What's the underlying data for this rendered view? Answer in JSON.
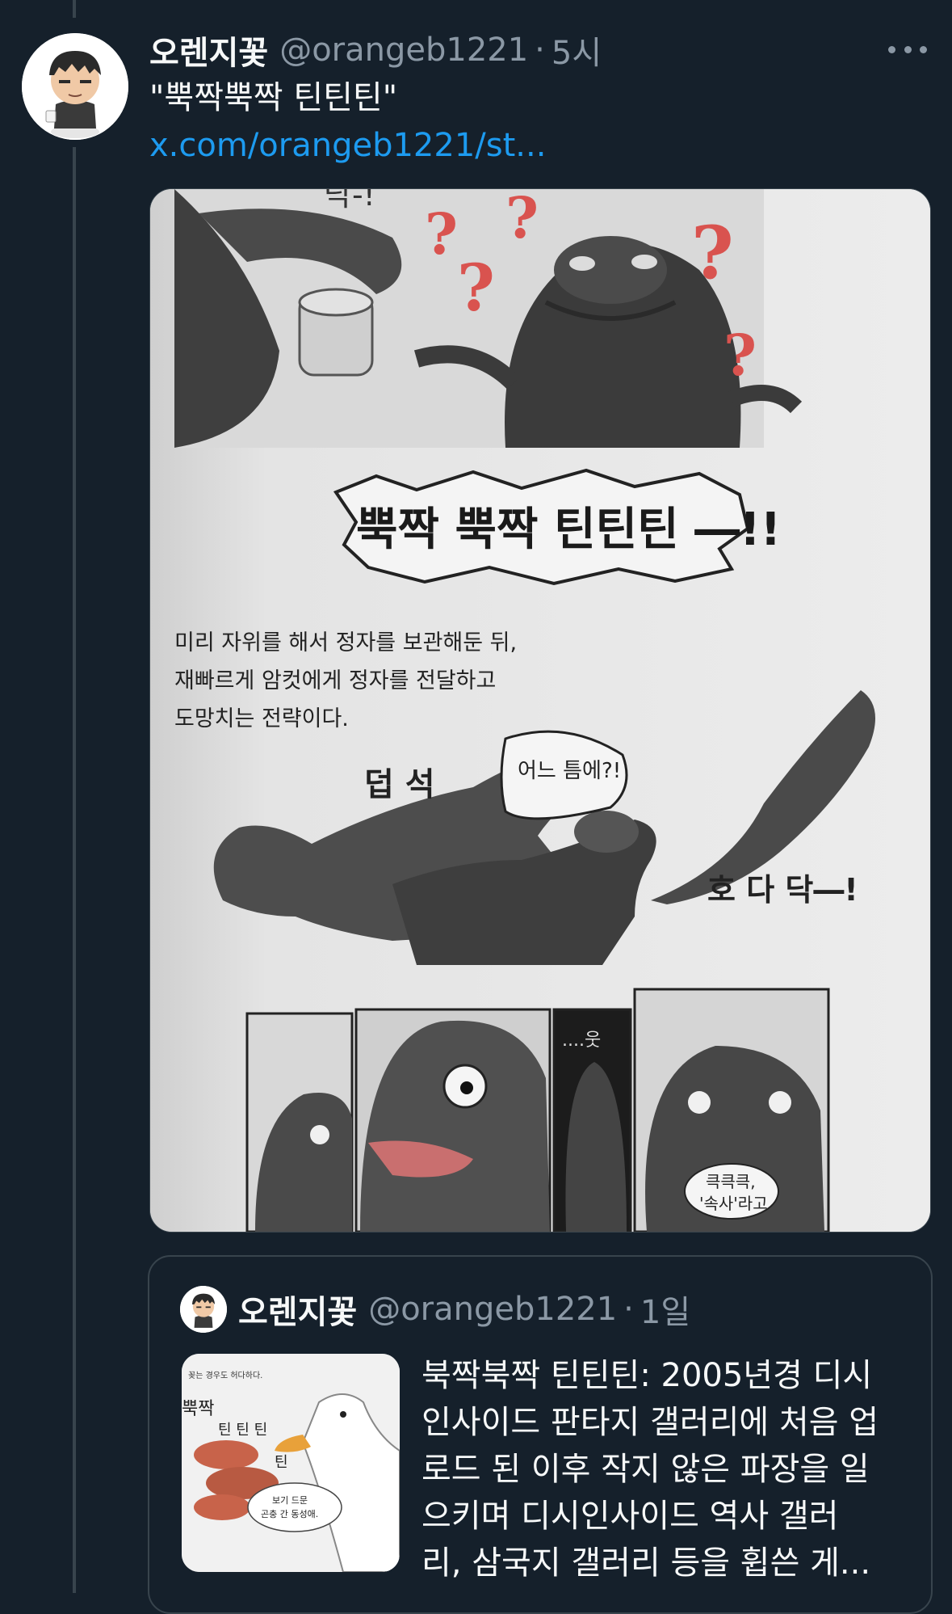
{
  "tweet": {
    "author_name": "오렌지꽃",
    "author_handle": "@orangeb1221",
    "separator": "·",
    "time": "5시",
    "text": "\"뿍짝뿍짝 틴틴틴\"",
    "link": "x.com/orangeb1221/st..."
  },
  "media": {
    "comic_texts": {
      "shout": "뿍짝 뿍짝 틴틴틴 ―!!",
      "narration_1": "미리 자위를 해서 정자를 보관해둔 뒤,",
      "narration_2": "재빠르게 암컷에게 정자를 전달하고",
      "narration_3": "도망치는 전략이다.",
      "sfx_grab": "덥 석",
      "speech_when": "어느 틈에?!",
      "sfx_run": "호 다 닥―!",
      "sfx_dots": "....웃",
      "speech_laugh_1": "큭큭큭,",
      "speech_laugh_2": "'속사'라고",
      "sfx_top": "닥-!"
    }
  },
  "quote": {
    "author_name": "오렌지꽃",
    "author_handle": "@orangeb1221",
    "separator": "·",
    "time": "1일",
    "lines": [
      "북짝북짝 틴틴틴: 2005년경 디시",
      "인사이드 판타지 갤러리에 처음 업",
      "로드 된 이후 작지 않은 파장을 일",
      "으키며 디시인사이드 역사 갤러",
      "리, 삼국지 갤러리 등을 휩쓴 게..."
    ],
    "thumb_texts": {
      "top": "꽂는 경우도 허다하다.",
      "sfx_a": "뿍짝",
      "sfx_b": "틴 틴 틴",
      "sfx_c": "틴",
      "speech_1": "보기 드문",
      "speech_2": "곤충 간 동성애."
    }
  },
  "colors": {
    "background": "#15202b",
    "text_primary": "#f7f9f9",
    "text_secondary": "#8b98a5",
    "link": "#1d9bf0",
    "border": "#38444d"
  }
}
